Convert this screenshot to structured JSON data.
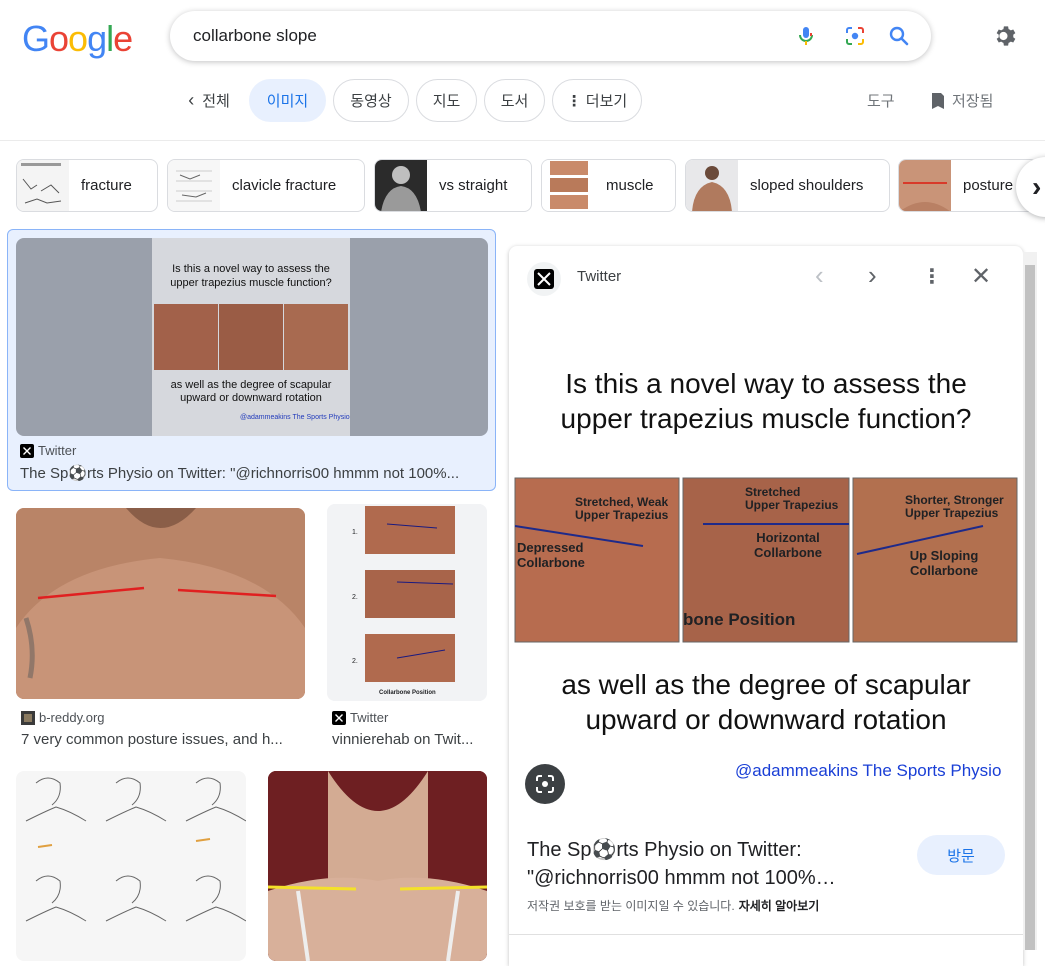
{
  "search": {
    "query": "collarbone slope"
  },
  "logo": {
    "letters": [
      "G",
      "o",
      "o",
      "g",
      "l",
      "e"
    ],
    "colors": [
      "#4285F4",
      "#EA4335",
      "#FBBC05",
      "#4285F4",
      "#34A853",
      "#EA4335"
    ]
  },
  "tabs": [
    {
      "label": "전체"
    },
    {
      "label": "이미지"
    },
    {
      "label": "동영상"
    },
    {
      "label": "지도"
    },
    {
      "label": "도서"
    },
    {
      "label": "더보기"
    }
  ],
  "tools": {
    "tools_label": "도구",
    "saved_label": "저장됨"
  },
  "chips": [
    {
      "label": "fracture"
    },
    {
      "label": "clavicle fracture"
    },
    {
      "label": "vs straight"
    },
    {
      "label": "muscle"
    },
    {
      "label": "sloped shoulders"
    },
    {
      "label": "posture"
    }
  ],
  "results": [
    {
      "source": "Twitter",
      "title": "The Sp⚽rts Physio on Twitter: \"@richnorris00 hmmm not 100%..."
    },
    {
      "source": "b-reddy.org",
      "title": "7 very common posture issues, and h..."
    },
    {
      "source": "Twitter",
      "title": "vinnierehab on Twit..."
    }
  ],
  "thumb_infographic": {
    "line1": "Is this a novel way to assess the",
    "line2": "upper trapezius muscle function?",
    "line3": "as well as the degree of scapular",
    "line4": "upward or downward rotation",
    "credit": "@adammeakins The Sports Physio",
    "labels": [
      "Depressed Collarbone",
      "Horizontal Collarbone",
      "Up Sloping Collarbone"
    ],
    "sublabels": [
      "Stretched, Weak Upper Trapezius",
      "Stretched Upper Trapezius",
      "Shorter, Stronger Upper Trapezius"
    ],
    "bottom_label": "bone Position"
  },
  "collar_chart": {
    "labels": [
      "1.",
      "2.",
      "2."
    ],
    "caption": "Collarbone Position"
  },
  "panel": {
    "site": "Twitter",
    "title": "The Sp⚽rts Physio on Twitter: \"@richnorris00 hmmm not 100%…",
    "visit_label": "방문",
    "copyright": "저작권 보호를 받는 이미지일 수 있습니다.",
    "learn_more": "자세히 알아보기",
    "headline1": "Is this a novel way to assess the",
    "headline2": "upper trapezius muscle function?",
    "subline1": "as well as the degree of scapular",
    "subline2": "upward or downward rotation",
    "credit": "@adammeakins The Sports Physio",
    "photo_labels": [
      "Depressed\nCollarbone",
      "Horizontal\nCollarbone",
      "Up Sloping\nCollarbone"
    ],
    "photo_sublabels": [
      "Stretched, Weak\nUpper Trapezius",
      "Stretched\nUpper Trapezius",
      "Shorter, Stronger\nUpper Trapezius"
    ],
    "photo_bottom": "bone Position"
  }
}
